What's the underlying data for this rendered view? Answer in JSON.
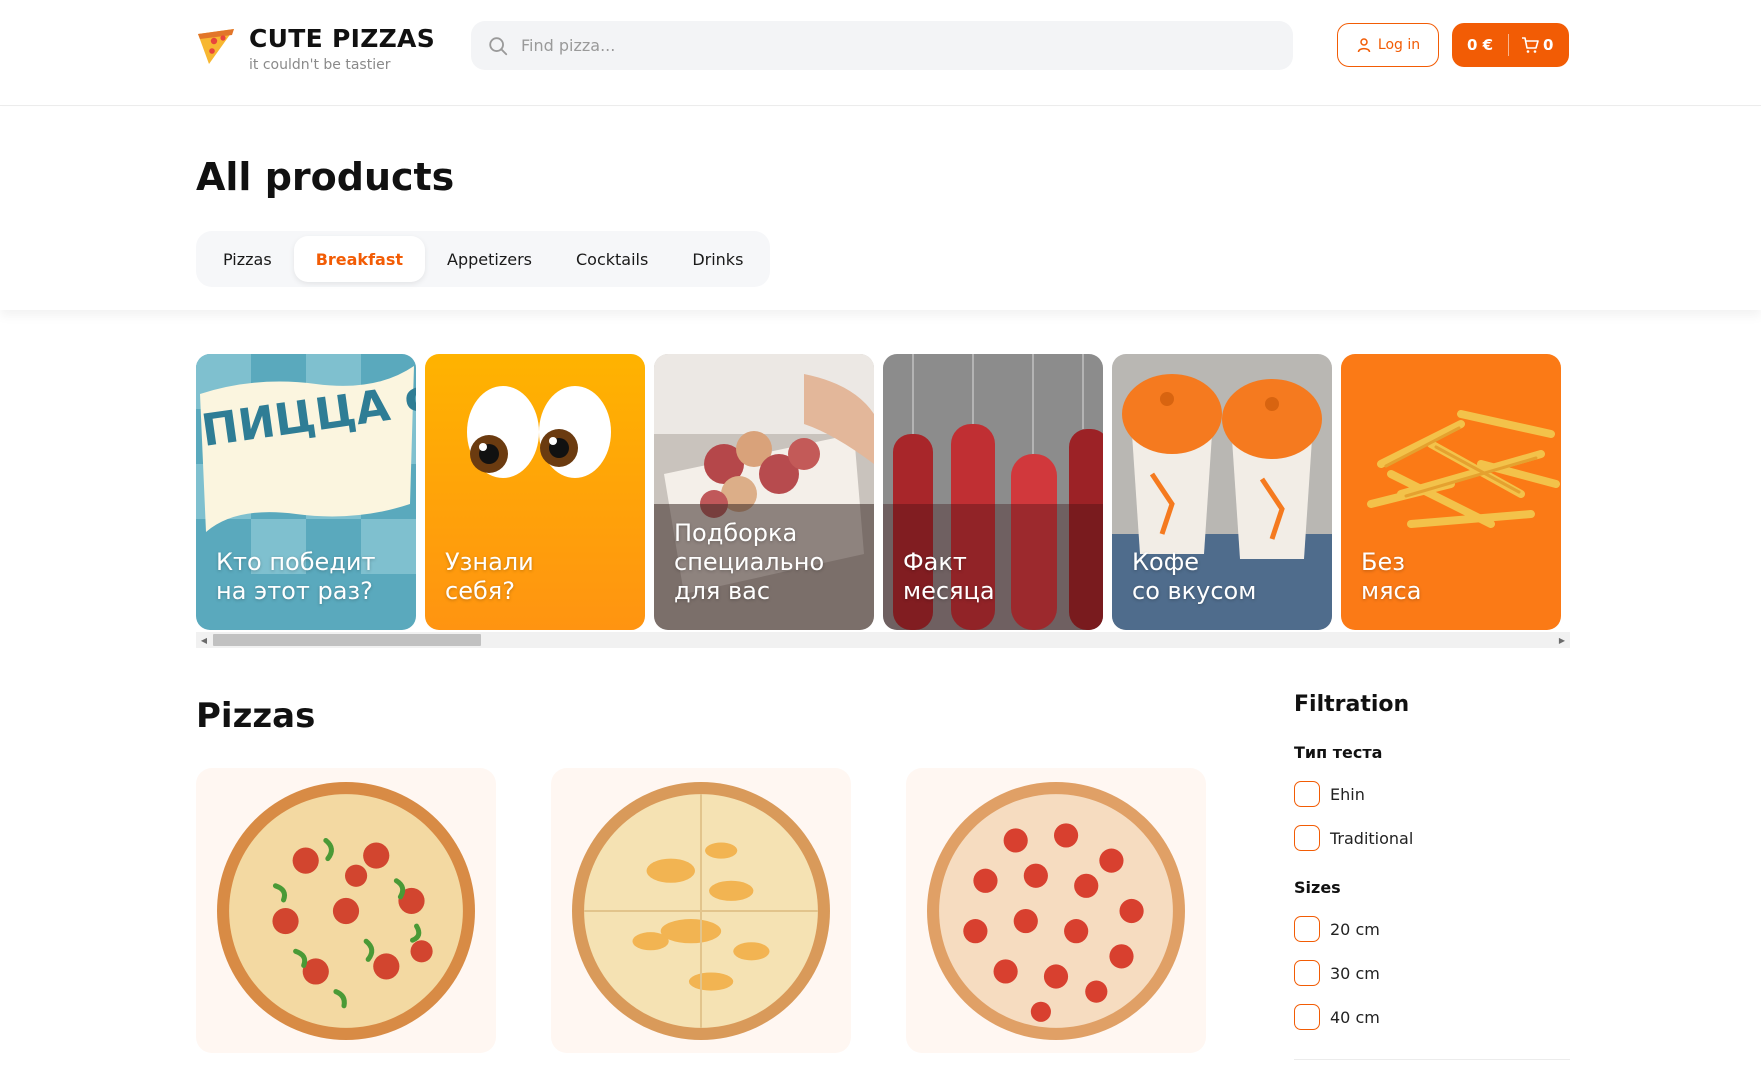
{
  "header": {
    "brand_title": "CUTE PIZZAS",
    "brand_subtitle": "it couldn't be tastier",
    "search_placeholder": "Find pizza...",
    "login_label": "Log in",
    "cart_price": "0 €",
    "cart_count": "0",
    "accent_color": "#f25c05"
  },
  "page": {
    "title": "All products",
    "tabs": [
      {
        "label": "Pizzas",
        "active": false
      },
      {
        "label": "Breakfast",
        "active": true
      },
      {
        "label": "Appetizers",
        "active": false
      },
      {
        "label": "Cocktails",
        "active": false
      },
      {
        "label": "Drinks",
        "active": false
      }
    ]
  },
  "stories": [
    {
      "text": "Кто победит\nна этот раз?",
      "image": "pizza-fest-banner",
      "logo_text": "ПИЦЦА ФЕСТ"
    },
    {
      "text": "Узнали\nсебя?",
      "image": "eyes-emoji"
    },
    {
      "text": "Подборка\nспециально\nдля вас",
      "image": "dough-bites-box"
    },
    {
      "text": "Факт\nмесяца",
      "image": "hanging-sausages"
    },
    {
      "text": "Кофе\nсо вкусом",
      "image": "coffee-cups"
    },
    {
      "text": "Без\nмяса",
      "image": "french-fries"
    }
  ],
  "products_section": {
    "title": "Pizzas",
    "items": [
      {
        "image": "pepperoni-pepper-pizza"
      },
      {
        "image": "cheese-pizza"
      },
      {
        "image": "pepperoni-pizza"
      }
    ]
  },
  "filters": {
    "title": "Filtration",
    "groups": [
      {
        "title": "Тип теста",
        "options": [
          "Ehin",
          "Traditional"
        ]
      },
      {
        "title": "Sizes",
        "options": [
          "20 cm",
          "30 cm",
          "40 cm"
        ]
      }
    ]
  }
}
